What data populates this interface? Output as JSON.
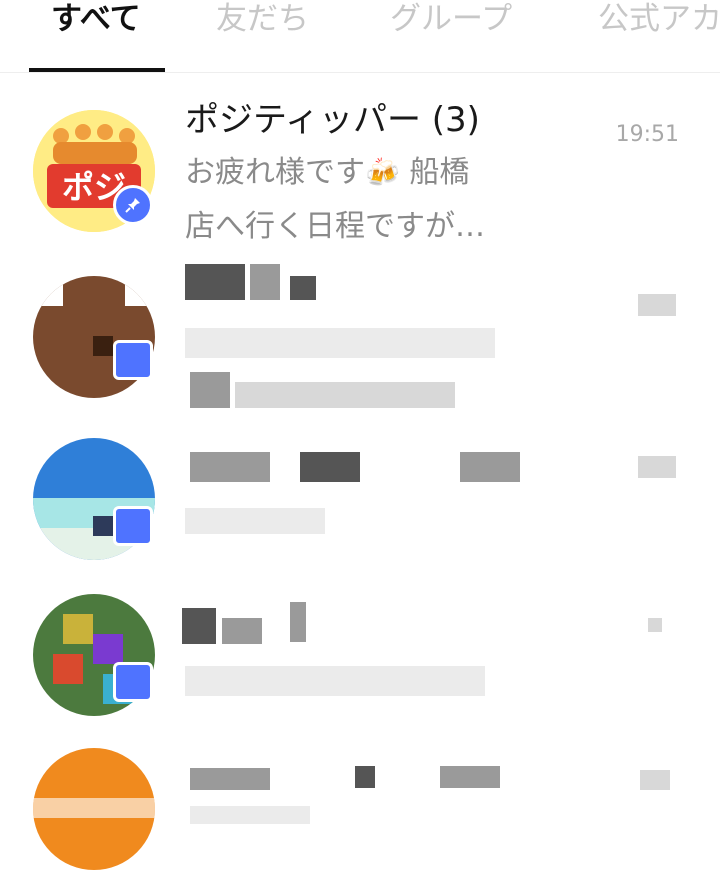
{
  "tabs": [
    {
      "label": "すべて",
      "active": true
    },
    {
      "label": "友だち",
      "active": false
    },
    {
      "label": "グループ",
      "active": false
    },
    {
      "label": "公式アカ",
      "active": false
    }
  ],
  "chats": [
    {
      "name": "ポジティッパー (3)",
      "message_line1": "お疲れ様です",
      "message_emoji": "🍻",
      "message_line1_after": " 船橋",
      "message_line2": "店へ行く日程ですが…",
      "time": "19:51",
      "avatar_text": "ポジ",
      "pinned": true
    },
    {
      "name": "",
      "message": "",
      "time": "",
      "obscured": true
    },
    {
      "name": "",
      "message": "",
      "time": "",
      "obscured": true
    },
    {
      "name": "",
      "message": "",
      "time": "",
      "obscured": true
    },
    {
      "name": "",
      "message": "",
      "time": "",
      "obscured": true
    }
  ],
  "colors": {
    "accent_blue": "#4f73ff",
    "active_tab": "#111111",
    "inactive_tab": "#c7c7c7"
  }
}
